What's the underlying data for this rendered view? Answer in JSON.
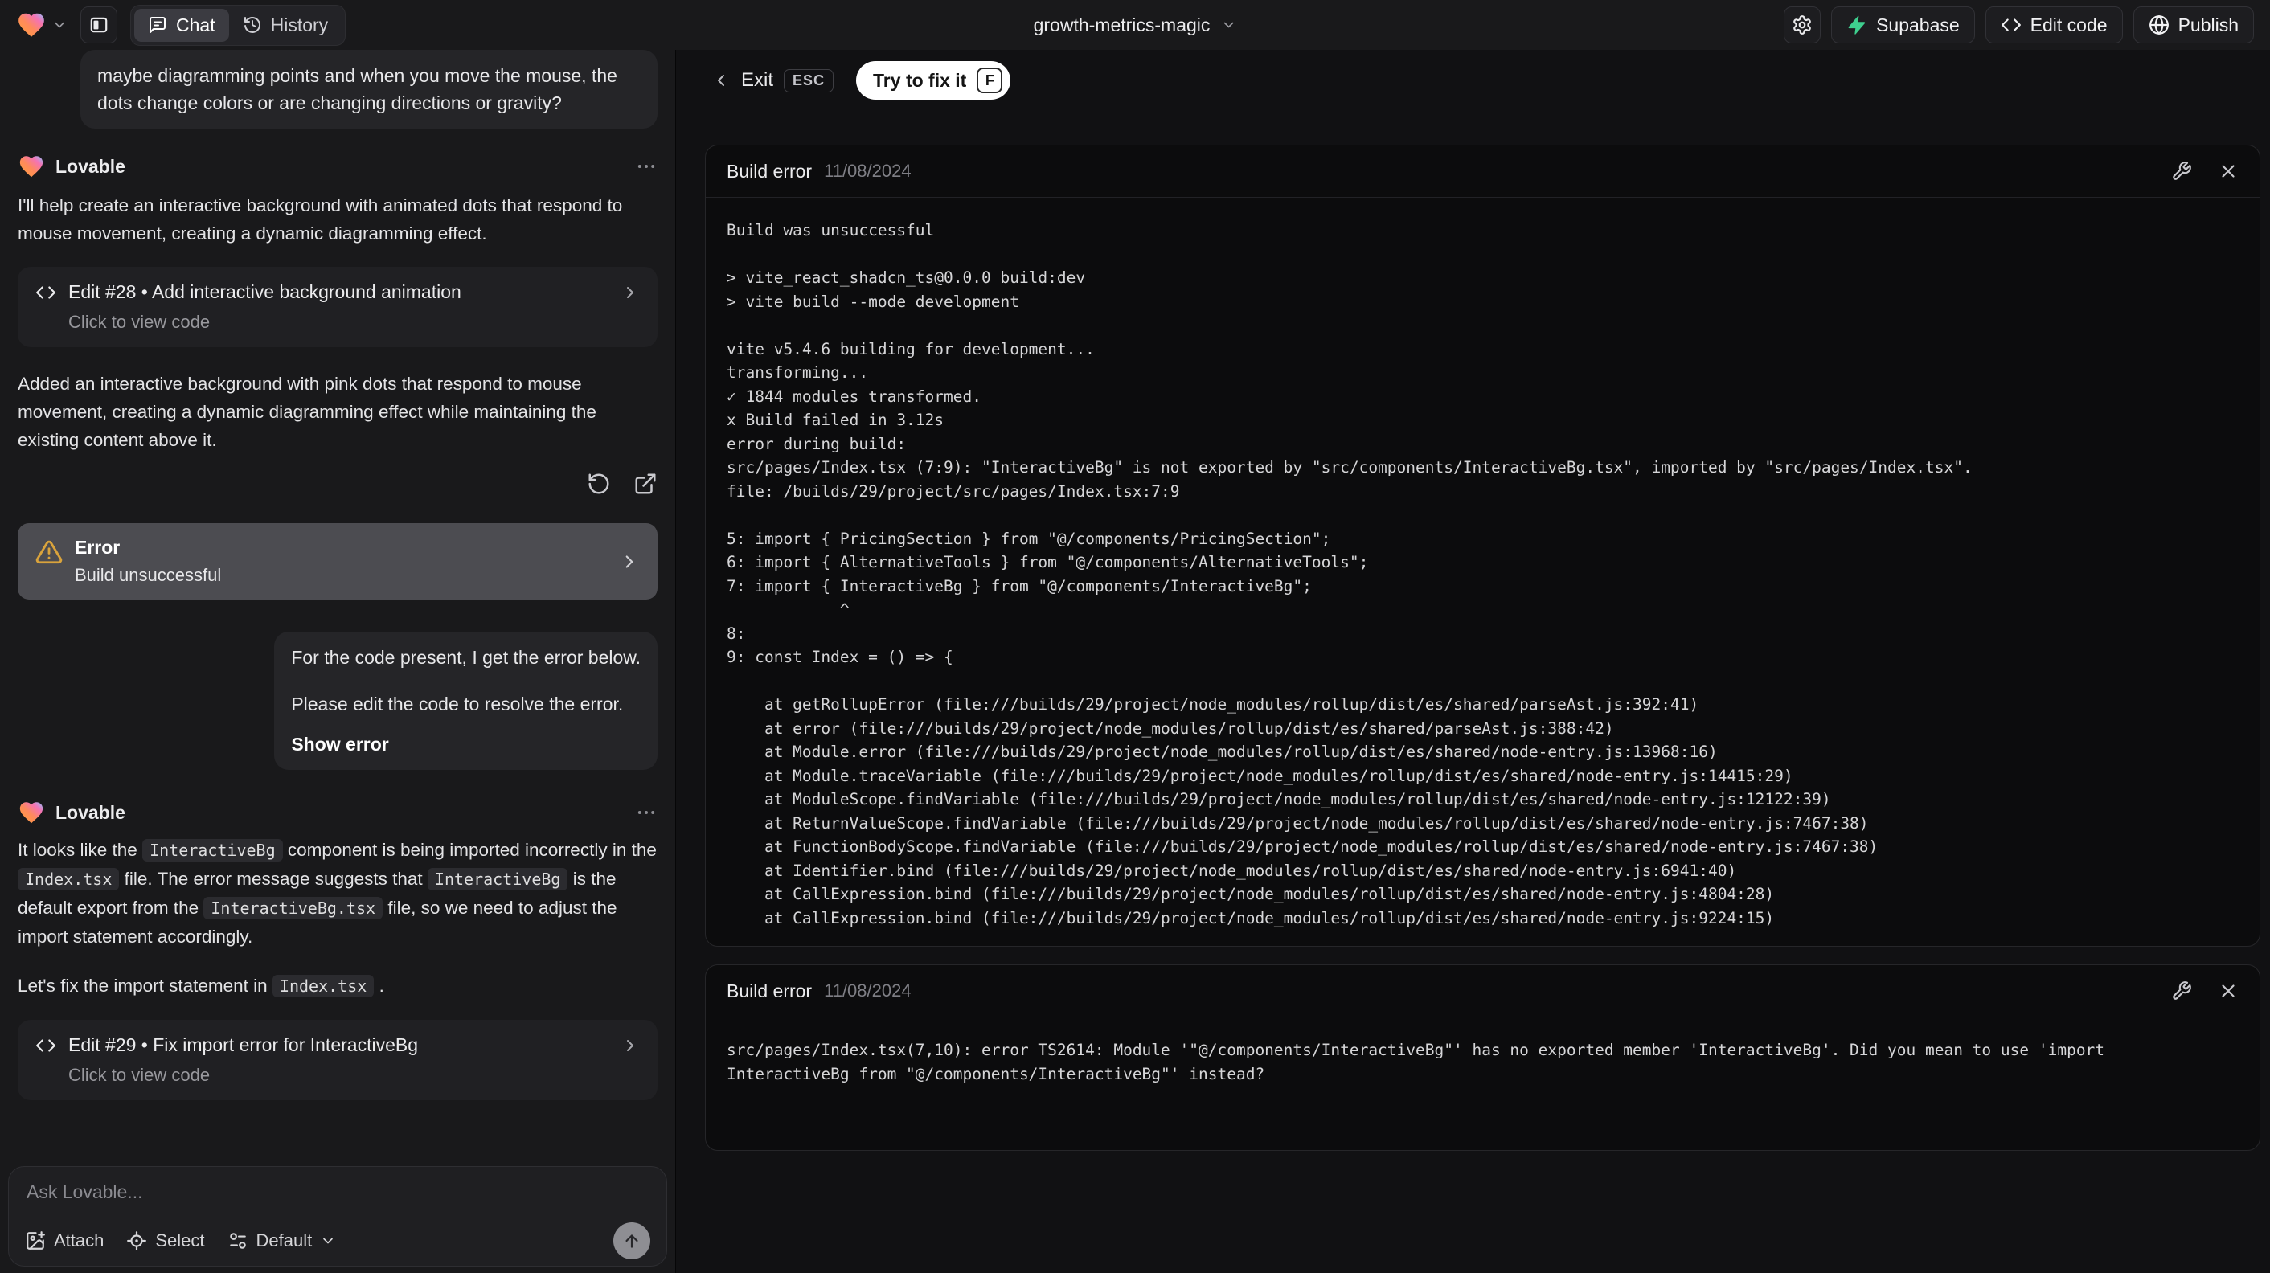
{
  "topbar": {
    "project_name": "growth-metrics-magic",
    "tabs": [
      {
        "label": "Chat"
      },
      {
        "label": "History"
      }
    ],
    "actions": {
      "supabase": "Supabase",
      "edit_code": "Edit code",
      "publish": "Publish"
    }
  },
  "colors": {
    "supabase_green": "#3ecf8e",
    "warning_amber": "#d9a33c",
    "fix_button_bg": "#ffffff"
  },
  "chat": {
    "assistant_name": "Lovable",
    "user_message_1": "maybe diagramming points and when you move the mouse, the dots change colors or are changing directions or gravity?",
    "assistant_intro": "I'll help create an interactive background with animated dots that respond to mouse movement, creating a dynamic diagramming effect.",
    "edit_card_1": {
      "title": "Edit #28 • Add interactive background animation",
      "subtitle": "Click to view code"
    },
    "assistant_summary": "Added an interactive background with pink dots that respond to mouse movement, creating a dynamic diagramming effect while maintaining the existing content above it.",
    "error_card": {
      "title": "Error",
      "subtitle": "Build unsuccessful"
    },
    "user_message_2": {
      "line_1": "For the code present, I get the error below.",
      "line_2": "Please edit the code to resolve the error.",
      "action": "Show error"
    },
    "assistant_fix_intro_segments": [
      {
        "text": "It looks like the "
      },
      {
        "code": "InteractiveBg"
      },
      {
        "text": " component is being imported incorrectly in the "
      },
      {
        "code": "Index.tsx"
      },
      {
        "text": " file. The error message suggests that "
      },
      {
        "code": "InteractiveBg"
      },
      {
        "text": " is the default export from the "
      },
      {
        "code": "InteractiveBg.tsx"
      },
      {
        "text": " file, so we need to adjust the import statement accordingly."
      }
    ],
    "assistant_fix_action_segments": [
      {
        "text": "Let's fix the import statement in "
      },
      {
        "code": "Index.tsx"
      },
      {
        "text": " ."
      }
    ],
    "edit_card_2": {
      "title": "Edit #29 • Fix import error for InteractiveBg",
      "subtitle": "Click to view code"
    },
    "composer": {
      "placeholder": "Ask Lovable...",
      "attach": "Attach",
      "select": "Select",
      "mode": "Default"
    }
  },
  "error_view": {
    "exit_label": "Exit",
    "exit_key": "ESC",
    "fix_button_label": "Try to fix it",
    "fix_button_key": "F",
    "panels": [
      {
        "title": "Build error",
        "date": "11/08/2024",
        "log_lines": [
          "Build was unsuccessful",
          "",
          "> vite_react_shadcn_ts@0.0.0 build:dev",
          "> vite build --mode development",
          "",
          "vite v5.4.6 building for development...",
          "transforming...",
          "✓ 1844 modules transformed.",
          "x Build failed in 3.12s",
          "error during build:",
          "src/pages/Index.tsx (7:9): \"InteractiveBg\" is not exported by \"src/components/InteractiveBg.tsx\", imported by \"src/pages/Index.tsx\".",
          "file: /builds/29/project/src/pages/Index.tsx:7:9",
          "",
          "5: import { PricingSection } from \"@/components/PricingSection\";",
          "6: import { AlternativeTools } from \"@/components/AlternativeTools\";",
          "7: import { InteractiveBg } from \"@/components/InteractiveBg\";",
          "            ^",
          "8:",
          "9: const Index = () => {",
          "",
          "    at getRollupError (file:///builds/29/project/node_modules/rollup/dist/es/shared/parseAst.js:392:41)",
          "    at error (file:///builds/29/project/node_modules/rollup/dist/es/shared/parseAst.js:388:42)",
          "    at Module.error (file:///builds/29/project/node_modules/rollup/dist/es/shared/node-entry.js:13968:16)",
          "    at Module.traceVariable (file:///builds/29/project/node_modules/rollup/dist/es/shared/node-entry.js:14415:29)",
          "    at ModuleScope.findVariable (file:///builds/29/project/node_modules/rollup/dist/es/shared/node-entry.js:12122:39)",
          "    at ReturnValueScope.findVariable (file:///builds/29/project/node_modules/rollup/dist/es/shared/node-entry.js:7467:38)",
          "    at FunctionBodyScope.findVariable (file:///builds/29/project/node_modules/rollup/dist/es/shared/node-entry.js:7467:38)",
          "    at Identifier.bind (file:///builds/29/project/node_modules/rollup/dist/es/shared/node-entry.js:6941:40)",
          "    at CallExpression.bind (file:///builds/29/project/node_modules/rollup/dist/es/shared/node-entry.js:4804:28)",
          "    at CallExpression.bind (file:///builds/29/project/node_modules/rollup/dist/es/shared/node-entry.js:9224:15)"
        ]
      },
      {
        "title": "Build error",
        "date": "11/08/2024",
        "log_lines": [
          "src/pages/Index.tsx(7,10): error TS2614: Module '\"@/components/InteractiveBg\"' has no exported member 'InteractiveBg'. Did you mean to use 'import",
          "InteractiveBg from \"@/components/InteractiveBg\"' instead?"
        ]
      }
    ]
  }
}
